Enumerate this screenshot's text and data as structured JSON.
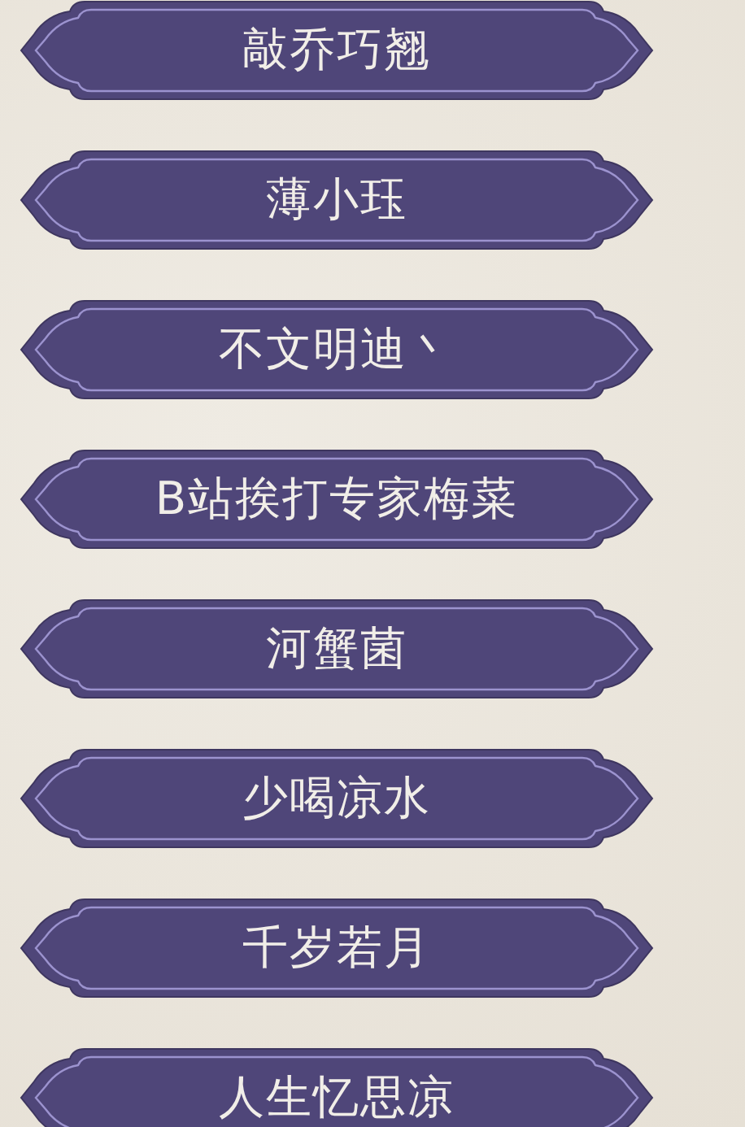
{
  "names": [
    {
      "label": "敲乔巧翘"
    },
    {
      "label": "薄小珏"
    },
    {
      "label": "不文明迪丶"
    },
    {
      "label": "B站挨打专家梅菜"
    },
    {
      "label": "河蟹菌"
    },
    {
      "label": "少喝凉水"
    },
    {
      "label": "千岁若月"
    },
    {
      "label": "人生忆思凉"
    }
  ]
}
